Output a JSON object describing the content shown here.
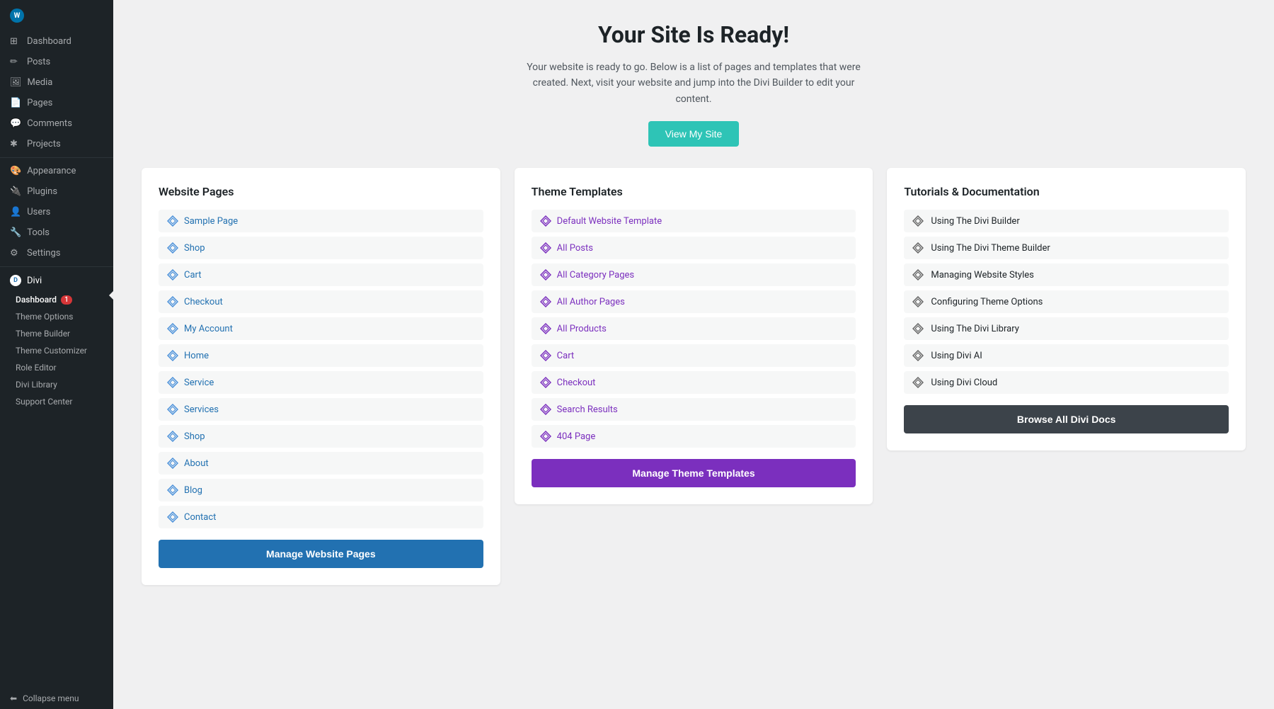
{
  "sidebar": {
    "logo": {
      "icon": "W",
      "text": ""
    },
    "items": [
      {
        "id": "dashboard",
        "label": "Dashboard",
        "icon": "⊞"
      },
      {
        "id": "posts",
        "label": "Posts",
        "icon": "✎"
      },
      {
        "id": "media",
        "label": "Media",
        "icon": "⊟"
      },
      {
        "id": "pages",
        "label": "Pages",
        "icon": "▣"
      },
      {
        "id": "comments",
        "label": "Comments",
        "icon": "💬"
      },
      {
        "id": "projects",
        "label": "Projects",
        "icon": "✱"
      },
      {
        "id": "appearance",
        "label": "Appearance",
        "icon": "🎨"
      },
      {
        "id": "plugins",
        "label": "Plugins",
        "icon": "⚙"
      },
      {
        "id": "users",
        "label": "Users",
        "icon": "👤"
      },
      {
        "id": "tools",
        "label": "Tools",
        "icon": "🔧"
      },
      {
        "id": "settings",
        "label": "Settings",
        "icon": "⚙"
      }
    ],
    "divi": {
      "label": "Divi",
      "icon": "D"
    },
    "sub_items": [
      {
        "id": "divi-dashboard",
        "label": "Dashboard",
        "badge": "1"
      },
      {
        "id": "theme-options",
        "label": "Theme Options",
        "badge": null
      },
      {
        "id": "theme-builder",
        "label": "Theme Builder",
        "badge": null
      },
      {
        "id": "theme-customizer",
        "label": "Theme Customizer",
        "badge": null
      },
      {
        "id": "role-editor",
        "label": "Role Editor",
        "badge": null
      },
      {
        "id": "divi-library",
        "label": "Divi Library",
        "badge": null
      },
      {
        "id": "support-center",
        "label": "Support Center",
        "badge": null
      }
    ],
    "collapse": "Collapse menu"
  },
  "header": {
    "title": "Your Site Is Ready!",
    "subtitle": "Your website is ready to go. Below is a list of pages and templates that were created. Next, visit your website and jump into the Divi Builder to edit your content.",
    "view_site_btn": "View My Site"
  },
  "website_pages": {
    "title": "Website Pages",
    "items": [
      "Sample Page",
      "Shop",
      "Cart",
      "Checkout",
      "My Account",
      "Home",
      "Service",
      "Services",
      "Shop",
      "About",
      "Blog",
      "Contact"
    ],
    "btn": "Manage Website Pages"
  },
  "theme_templates": {
    "title": "Theme Templates",
    "items": [
      "Default Website Template",
      "All Posts",
      "All Category Pages",
      "All Author Pages",
      "All Products",
      "Cart",
      "Checkout",
      "Search Results",
      "404 Page"
    ],
    "btn": "Manage Theme Templates"
  },
  "tutorials": {
    "title": "Tutorials & Documentation",
    "items": [
      "Using The Divi Builder",
      "Using The Divi Theme Builder",
      "Managing Website Styles",
      "Configuring Theme Options",
      "Using The Divi Library",
      "Using Divi AI",
      "Using Divi Cloud"
    ],
    "btn": "Browse All Divi Docs"
  }
}
